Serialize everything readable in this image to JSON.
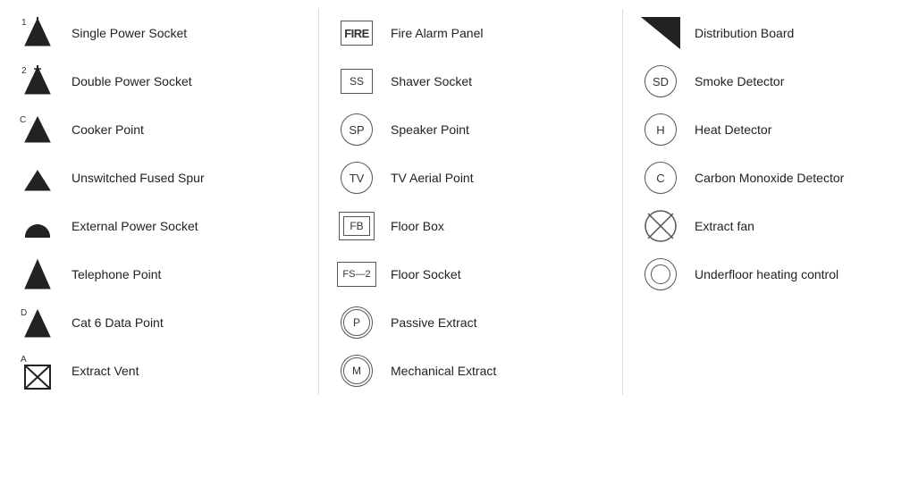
{
  "columns": [
    {
      "items": [
        {
          "id": "single-power-socket",
          "label": "Single Power Socket",
          "symbol": "single-power"
        },
        {
          "id": "double-power-socket",
          "label": "Double Power Socket",
          "symbol": "double-power"
        },
        {
          "id": "cooker-point",
          "label": "Cooker Point",
          "symbol": "cooker"
        },
        {
          "id": "unswitched-fused-spur",
          "label": "Unswitched Fused Spur",
          "symbol": "fused-spur"
        },
        {
          "id": "external-power-socket",
          "label": "External Power Socket",
          "symbol": "external-power"
        },
        {
          "id": "telephone-point",
          "label": "Telephone Point",
          "symbol": "telephone"
        },
        {
          "id": "cat6-data-point",
          "label": "Cat 6 Data Point",
          "symbol": "cat6"
        },
        {
          "id": "extract-vent",
          "label": "Extract Vent",
          "symbol": "extract-vent"
        }
      ]
    },
    {
      "items": [
        {
          "id": "fire-alarm-panel",
          "label": "Fire Alarm Panel",
          "symbol": "fire-box"
        },
        {
          "id": "shaver-socket",
          "label": "Shaver Socket",
          "symbol": "ss-box"
        },
        {
          "id": "speaker-point",
          "label": "Speaker Point",
          "symbol": "sp-circle"
        },
        {
          "id": "tv-aerial-point",
          "label": "TV Aerial Point",
          "symbol": "tv-circle"
        },
        {
          "id": "floor-box",
          "label": "Floor Box",
          "symbol": "fb-double-box"
        },
        {
          "id": "floor-socket",
          "label": "Floor Socket",
          "symbol": "fs2-box"
        },
        {
          "id": "passive-extract",
          "label": "Passive Extract",
          "symbol": "p-double-circle"
        },
        {
          "id": "mechanical-extract",
          "label": "Mechanical Extract",
          "symbol": "m-double-circle"
        }
      ]
    },
    {
      "items": [
        {
          "id": "distribution-board",
          "label": "Distribution Board",
          "symbol": "dist-board"
        },
        {
          "id": "smoke-detector",
          "label": "Smoke Detector",
          "symbol": "sd-circle"
        },
        {
          "id": "heat-detector",
          "label": "Heat Detector",
          "symbol": "h-circle"
        },
        {
          "id": "carbon-monoxide-detector",
          "label": "Carbon Monoxide Detector",
          "symbol": "c-circle"
        },
        {
          "id": "extract-fan",
          "label": "Extract fan",
          "symbol": "x-circle"
        },
        {
          "id": "underfloor-heating-control",
          "label": "Underfloor heating control",
          "symbol": "double-ring"
        }
      ]
    }
  ]
}
